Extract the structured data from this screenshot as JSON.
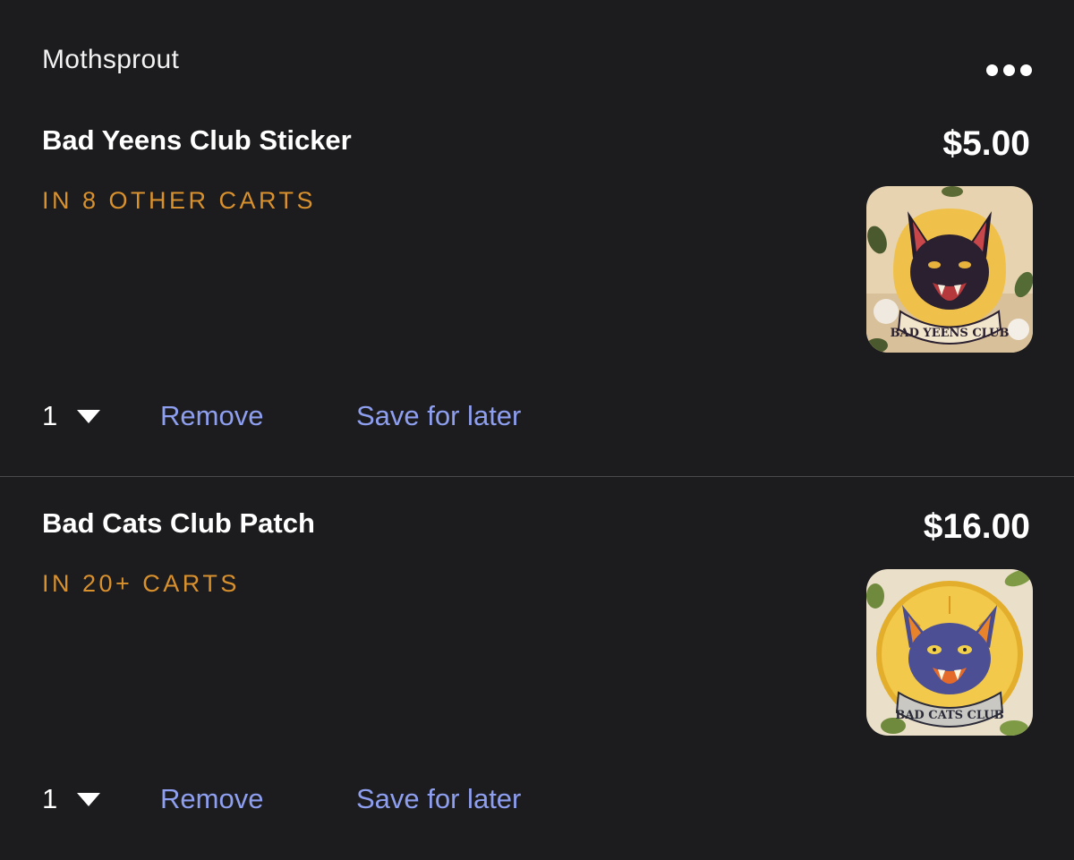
{
  "shop": {
    "name": "Mothsprout",
    "more_icon": "more-horizontal-icon"
  },
  "items": [
    {
      "title": "Bad Yeens Club Sticker",
      "cart_note": "IN 8 OTHER CARTS",
      "price": "$5.00",
      "quantity": "1",
      "remove_label": "Remove",
      "save_label": "Save for later",
      "image_text": "BAD YEENS CLUB"
    },
    {
      "title": "Bad Cats Club Patch",
      "cart_note": "IN 20+ CARTS",
      "price": "$16.00",
      "quantity": "1",
      "remove_label": "Remove",
      "save_label": "Save for later",
      "image_text": "BAD CATS CLUB"
    }
  ],
  "colors": {
    "background": "#1c1c1e",
    "accent_link": "#8f9ff0",
    "cart_note": "#d9912e",
    "divider": "#4a4a4e"
  }
}
